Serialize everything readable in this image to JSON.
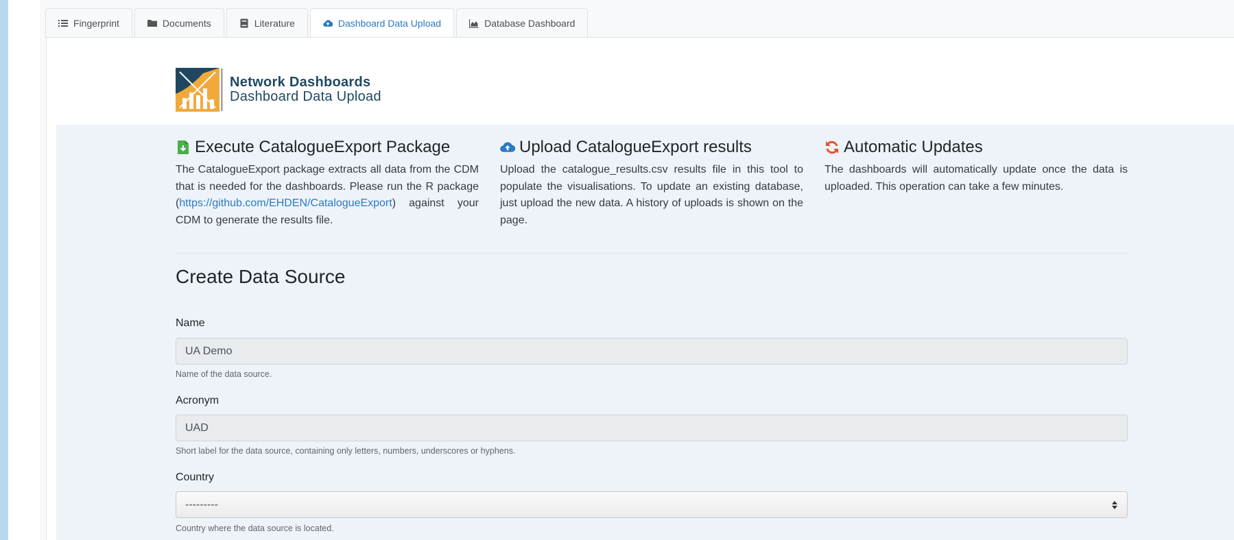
{
  "tabs": [
    {
      "label": "Fingerprint",
      "icon": "list-icon"
    },
    {
      "label": "Documents",
      "icon": "folder-icon"
    },
    {
      "label": "Literature",
      "icon": "book-icon"
    },
    {
      "label": "Dashboard Data Upload",
      "icon": "cloud-upload-icon",
      "active": true
    },
    {
      "label": "Database Dashboard",
      "icon": "area-chart-icon"
    }
  ],
  "brand": {
    "title": "Network Dashboards",
    "subtitle": "Dashboard Data Upload"
  },
  "info": {
    "execute": {
      "title": "Execute CatalogueExport Package",
      "text_before": "The CatalogueExport package extracts all data from the CDM that is needed for the dashboards. Please run the R package (",
      "link": "https://github.com/EHDEN/CatalogueExport",
      "text_after": ") against your CDM to generate the results file."
    },
    "upload": {
      "title": "Upload CatalogueExport results",
      "text": "Upload the catalogue_results.csv results file in this tool to populate the visualisations. To update an existing database, just upload the new data. A history of uploads is shown on the page."
    },
    "auto": {
      "title": "Automatic Updates",
      "text": "The dashboards will automatically update once the data is uploaded. This operation can take a few minutes."
    }
  },
  "form": {
    "title": "Create Data Source",
    "name": {
      "label": "Name",
      "value": "UA Demo",
      "help": "Name of the data source."
    },
    "acronym": {
      "label": "Acronym",
      "value": "UAD",
      "help": "Short label for the data source, containing only letters, numbers, underscores or hyphens."
    },
    "country": {
      "label": "Country",
      "value": "---------",
      "help": "Country where the data source is located."
    }
  },
  "colors": {
    "accent": "#2a7ac4",
    "brand": "#1f4860",
    "logo_orange": "#f2a93b",
    "refresh": "#e4532f",
    "doc_green": "#4cae4c"
  }
}
